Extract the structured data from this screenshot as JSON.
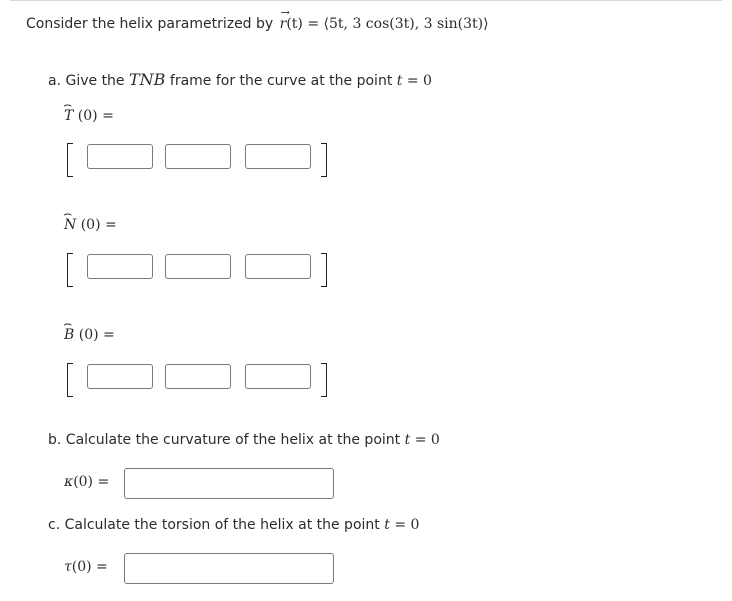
{
  "intro": {
    "lead": "Consider the helix parametrized by",
    "r": "r",
    "t_paren": "(t)",
    "equals": "=",
    "expr": "⟨5t, 3 cos(3t), 3 sin(3t)⟩"
  },
  "part_a": {
    "prefix": "a. Give the",
    "tnb": "TNB",
    "middle": "frame for the curve at the point",
    "t": "t",
    "eq_zero": "= 0"
  },
  "T": {
    "letter": "T",
    "arg": "(0) =",
    "values": [
      "",
      "",
      ""
    ]
  },
  "N": {
    "letter": "N",
    "arg": "(0) =",
    "values": [
      "",
      "",
      ""
    ]
  },
  "B": {
    "letter": "B",
    "arg": "(0) =",
    "values": [
      "",
      "",
      ""
    ]
  },
  "part_b": {
    "text": "b. Calculate the curvature of the helix at the point",
    "t": "t",
    "eq_zero": "= 0",
    "symbol": "κ",
    "arg": "(0) =",
    "value": ""
  },
  "part_c": {
    "text": "c. Calculate the torsion of the helix at the point",
    "t": "t",
    "eq_zero": "= 0",
    "symbol": "τ",
    "arg": "(0) =",
    "value": ""
  }
}
